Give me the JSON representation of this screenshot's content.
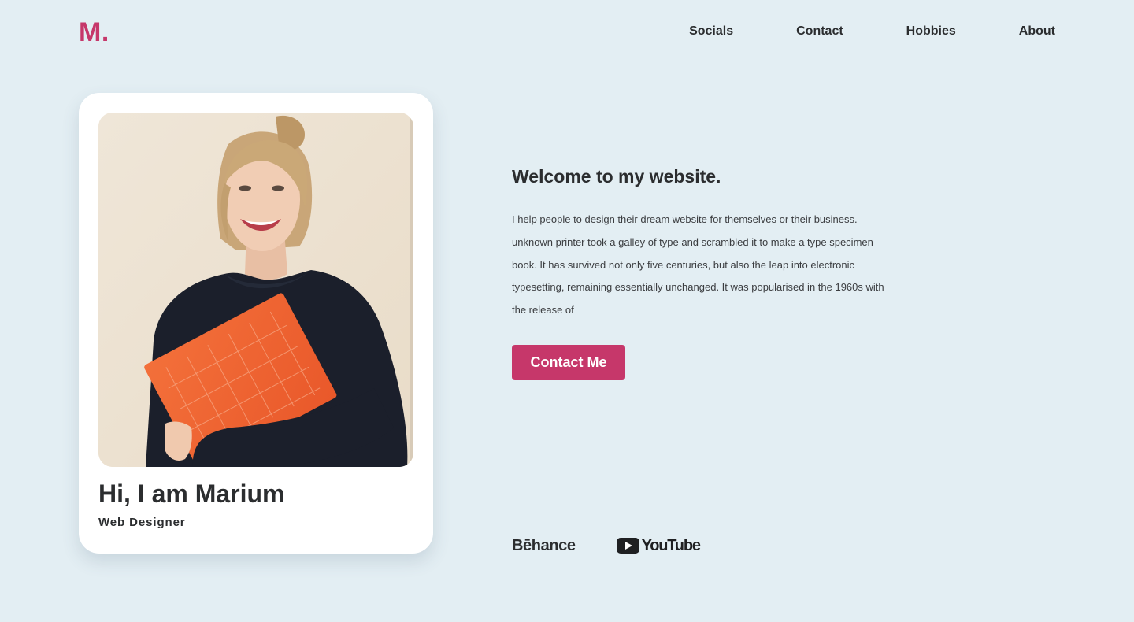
{
  "header": {
    "logo": "M.",
    "nav": [
      "Socials",
      "Contact",
      "Hobbies",
      "About"
    ]
  },
  "profile_card": {
    "name": "Hi, I am Marium",
    "role": "Web Designer"
  },
  "intro": {
    "heading": "Welcome to my website.",
    "body": "I help people to design their dream website for themselves or their business. unknown printer took a galley of type and scrambled it to make a type specimen book. It has survived not only five centuries, but also the leap into electronic typesetting, remaining essentially unchanged. It was popularised in the 1960s with the release of",
    "cta_label": "Contact Me"
  },
  "socials": {
    "behance": "Bēhance",
    "youtube": "YouTube"
  },
  "colors": {
    "background": "#e3eef3",
    "accent": "#c6376a",
    "text": "#2b2d2f",
    "card": "#ffffff"
  },
  "icons": [
    "youtube-play-icon"
  ]
}
